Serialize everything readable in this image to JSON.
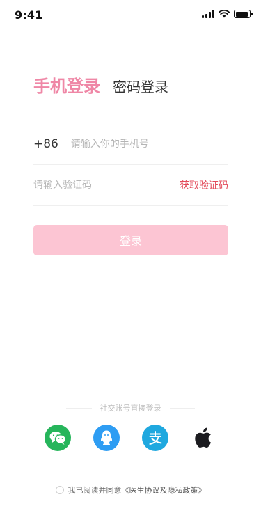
{
  "status_bar": {
    "time": "9:41",
    "battery_level": 0.9
  },
  "tabs": {
    "phone_login": "手机登录",
    "password_login": "密码登录"
  },
  "form": {
    "country_code": "+86",
    "phone_placeholder": "请输入你的手机号",
    "code_placeholder": "请输入验证码",
    "get_code_label": "获取验证码",
    "login_button": "登录"
  },
  "social": {
    "title": "社交账号直接登录",
    "icons": [
      "wechat-icon",
      "qq-icon",
      "alipay-icon",
      "apple-icon"
    ]
  },
  "agreement": {
    "prefix": "我已阅读并同意",
    "link": "《医生协议及隐私政策》"
  },
  "colors": {
    "accent": "#ef87a6",
    "button_bg": "#fcc5d3",
    "get_code": "#e34b5b",
    "wechat": "#26b55b",
    "qq": "#2e9df3",
    "alipay": "#1fa8df"
  }
}
